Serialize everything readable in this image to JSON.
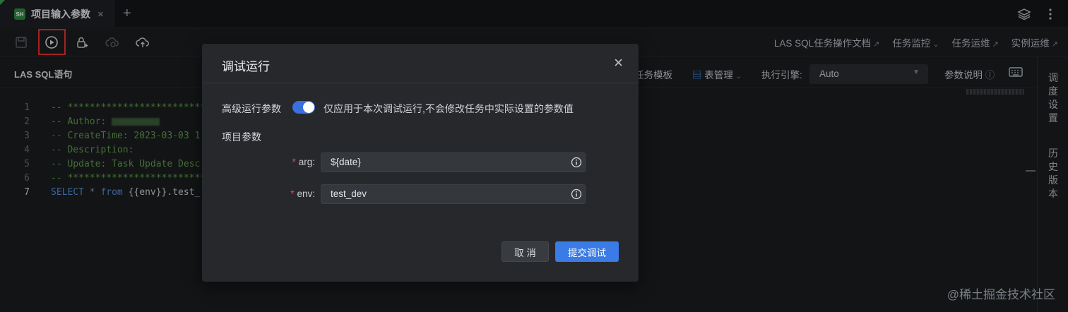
{
  "tab": {
    "icon_text": "SH",
    "title": "项目输入参数",
    "close": "×",
    "add": "+"
  },
  "toolbar": {
    "links": [
      "LAS SQL任务操作文档",
      "任务监控",
      "任务运维",
      "实例运维"
    ],
    "link_suffix": [
      "↗",
      "⌄",
      "↗",
      "↗"
    ]
  },
  "section": {
    "title": "LAS SQL语句",
    "template_label": "任务模板",
    "table_mgmt": "表管理",
    "engine_label": "执行引擎:",
    "engine_value": "Auto",
    "param_help": "参数说明"
  },
  "editor": {
    "lines": [
      {
        "num": "1",
        "text": "-- ****************************"
      },
      {
        "num": "2",
        "text": "-- Author: "
      },
      {
        "num": "3",
        "text": "-- CreateTime: 2023-03-03 1"
      },
      {
        "num": "4",
        "text": "-- Description:"
      },
      {
        "num": "5",
        "text": "-- Update: Task Update Desc"
      },
      {
        "num": "6",
        "text": "-- ****************************"
      },
      {
        "num": "7",
        "kw": "SELECT",
        "op": " * ",
        "kw2": "from",
        "rest": " {{env}}.test_"
      }
    ]
  },
  "sidepanel": {
    "schedule": "调度设置",
    "history": "历史版本"
  },
  "modal": {
    "title": "调试运行",
    "close": "×",
    "adv_label": "高级运行参数",
    "adv_enabled": true,
    "adv_hint": "仅应用于本次调试运行,不会修改任务中实际设置的参数值",
    "proj_label": "项目参数",
    "fields": [
      {
        "label": "arg:",
        "value": "${date}"
      },
      {
        "label": "env:",
        "value": "test_dev"
      }
    ],
    "cancel": "取 消",
    "submit": "提交调试"
  },
  "watermark": "@稀土掘金技术社区",
  "colors": {
    "accent": "#3a7be6",
    "highlight": "#e3312c",
    "comment": "#5f9b4b",
    "keyword": "#4d8fe0"
  }
}
